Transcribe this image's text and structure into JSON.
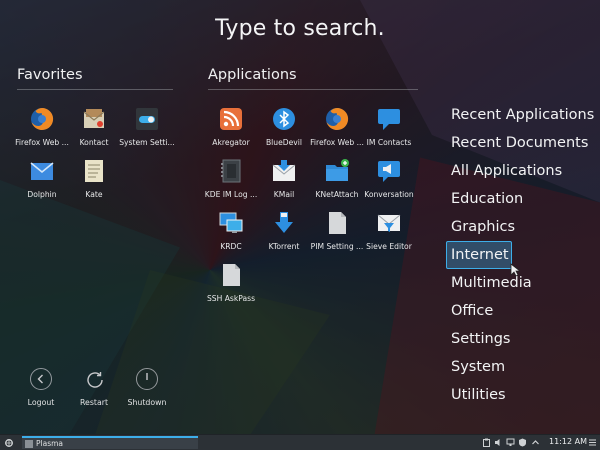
{
  "search": {
    "title": "Type to search."
  },
  "favorites": {
    "title": "Favorites",
    "apps": [
      {
        "label": "Firefox Web ...",
        "icon": "firefox-icon"
      },
      {
        "label": "Kontact",
        "icon": "kontact-icon"
      },
      {
        "label": "System Setti...",
        "icon": "system-settings-icon"
      },
      {
        "label": "Dolphin",
        "icon": "dolphin-icon"
      },
      {
        "label": "Kate",
        "icon": "kate-icon"
      }
    ]
  },
  "applications": {
    "title": "Applications",
    "apps": [
      {
        "label": "Akregator",
        "icon": "rss-icon"
      },
      {
        "label": "BlueDevil",
        "icon": "bluetooth-icon"
      },
      {
        "label": "Firefox Web ...",
        "icon": "firefox-icon"
      },
      {
        "label": "IM Contacts",
        "icon": "chat-icon"
      },
      {
        "label": "KDE IM Log ...",
        "icon": "log-viewer-icon"
      },
      {
        "label": "KMail",
        "icon": "mail-icon"
      },
      {
        "label": "KNetAttach",
        "icon": "folder-network-icon"
      },
      {
        "label": "Konversation",
        "icon": "irc-icon"
      },
      {
        "label": "KRDC",
        "icon": "remote-desktop-icon"
      },
      {
        "label": "KTorrent",
        "icon": "torrent-icon"
      },
      {
        "label": "PIM Setting ...",
        "icon": "generic-file-icon"
      },
      {
        "label": "Sieve Editor",
        "icon": "mail-filter-icon"
      },
      {
        "label": "SSH AskPass",
        "icon": "generic-file-icon"
      }
    ]
  },
  "categories": {
    "items": [
      "Recent Applications",
      "Recent Documents",
      "All Applications",
      "Education",
      "Graphics",
      "Internet",
      "Multimedia",
      "Office",
      "Settings",
      "System",
      "Utilities"
    ],
    "active": "Internet"
  },
  "power": {
    "logout": "Logout",
    "restart": "Restart",
    "shutdown": "Shutdown"
  },
  "panel": {
    "task_label": "Plasma",
    "clock": "11:12 AM"
  },
  "colors": {
    "accent": "#3daee9",
    "panel": "#2c3136"
  }
}
